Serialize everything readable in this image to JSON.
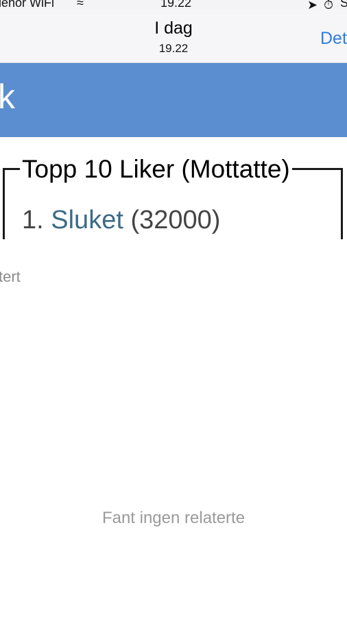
{
  "status_bar": {
    "carrier": "elenor WiFi",
    "time": "19.22"
  },
  "nav": {
    "title": "I dag",
    "subtitle": "19.22",
    "action": "Det"
  },
  "header": {
    "text": "kk"
  },
  "panel": {
    "legend": "Topp 10 Liker (Mottatte)",
    "items": [
      {
        "rank": "1.",
        "name": "Sluket",
        "count": "(32000)"
      }
    ]
  },
  "related": {
    "label": "tert",
    "empty_message": "Fant ingen relaterte"
  },
  "icons": [
    "wifi-icon",
    "location-arrow-icon",
    "alarm-icon"
  ],
  "colors": {
    "header_bg": "#5a8ed0",
    "link": "#3b6b86",
    "nav_action": "#2f7de1"
  }
}
